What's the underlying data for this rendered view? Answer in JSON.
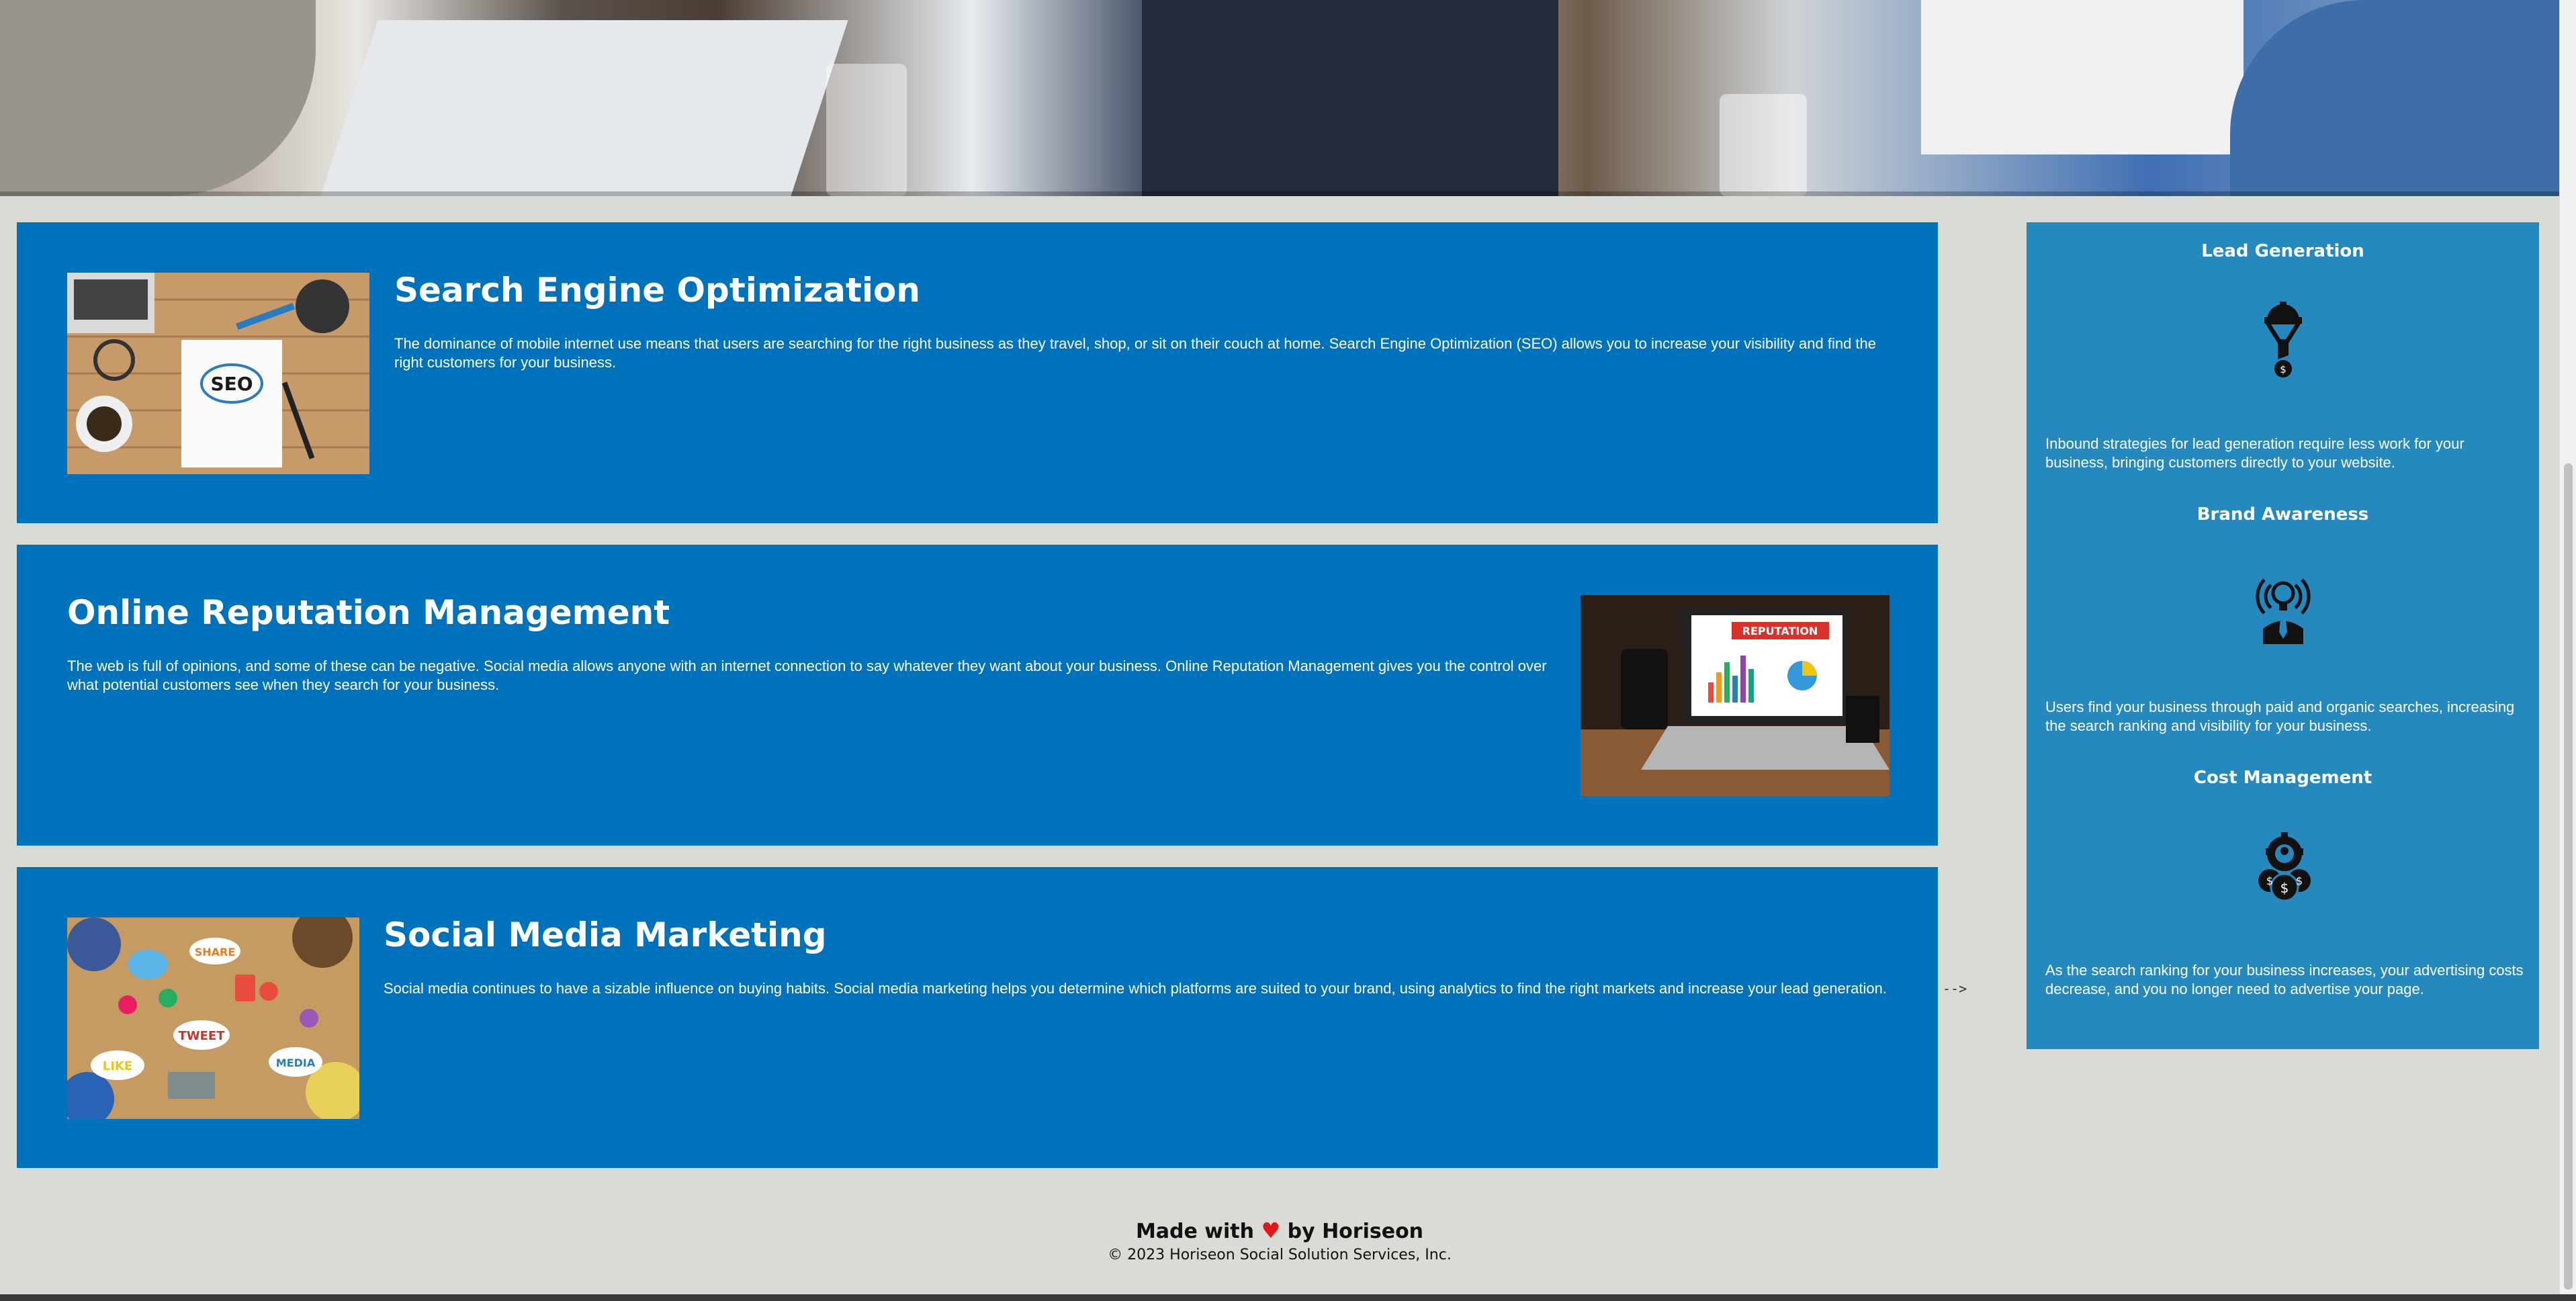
{
  "services": [
    {
      "title": "Search Engine Optimization",
      "text": "The dominance of mobile internet use means that users are searching for the right business as they travel, shop, or sit on their couch at home. Search Engine Optimization (SEO) allows you to increase your visibility and find the right customers for your business.",
      "image_label": "SEO"
    },
    {
      "title": "Online Reputation Management",
      "text": "The web is full of opinions, and some of these can be negative. Social media allows anyone with an internet connection to say whatever they want about your business. Online Reputation Management gives you the control over what potential customers see when they search for your business.",
      "image_label": "REPUTATION"
    },
    {
      "title": "Social Media Marketing",
      "text": "Social media continues to have a sizable influence on buying habits. Social media marketing helps you determine which platforms are suited to your brand, using analytics to find the right markets and increase your lead generation.",
      "image_labels": [
        "SHARE",
        "TWEET",
        "LIKE",
        "MEDIA"
      ]
    }
  ],
  "benefits": [
    {
      "title": "Lead Generation",
      "icon": "lead-generation-icon",
      "text": "Inbound strategies for lead generation require less work for your business, bringing customers directly to your website."
    },
    {
      "title": "Brand Awareness",
      "icon": "brand-awareness-icon",
      "text": "Users find your business through paid and organic searches, increasing the search ranking and visibility for your business."
    },
    {
      "title": "Cost Management",
      "icon": "cost-management-icon",
      "text": "As the search ranking for your business increases, your advertising costs decrease, and you no longer need to advertise your page."
    }
  ],
  "stray_comment": "-->",
  "footer": {
    "made_prefix": "Made with",
    "made_suffix": "by Horiseon",
    "copyright": "© 2023 Horiseon Social Solution Services, Inc."
  },
  "colors": {
    "card_blue": "#0072bb",
    "sidebar_blue": "#2589bd",
    "page_bg": "#d9dcd6",
    "heart": "#e01818"
  }
}
